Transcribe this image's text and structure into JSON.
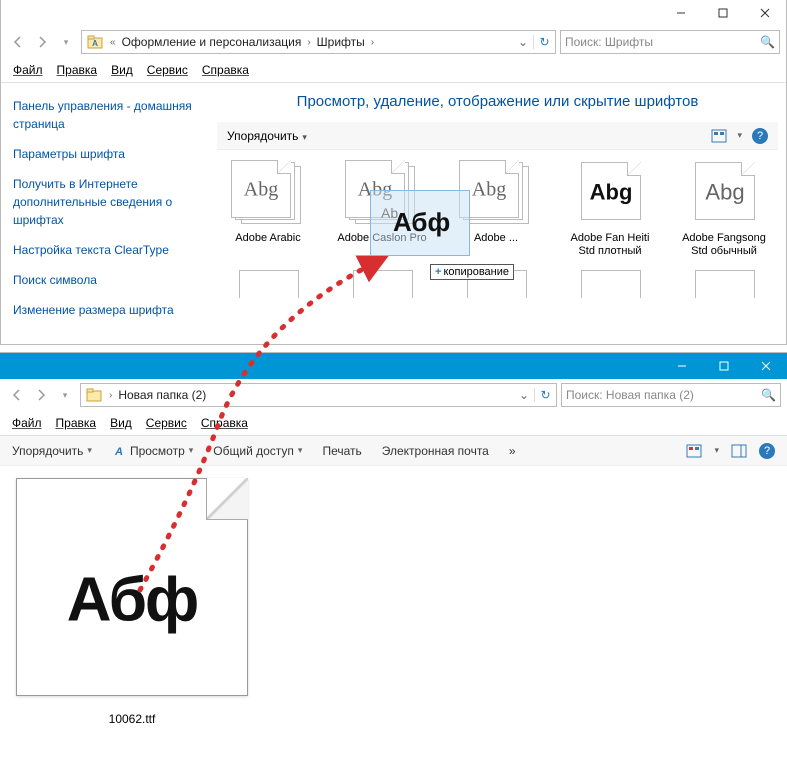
{
  "win1": {
    "breadcrumb": [
      "Оформление и персонализация",
      "Шрифты"
    ],
    "search_placeholder": "Поиск: Шрифты",
    "menu": [
      "Файл",
      "Правка",
      "Вид",
      "Сервис",
      "Справка"
    ],
    "sidebar": [
      "Панель управления - домашняя страница",
      "Параметры шрифта",
      "Получить в Интернете дополнительные сведения о шрифтах",
      "Настройка текста ClearType",
      "Поиск символа",
      "Изменение размера шрифта"
    ],
    "heading": "Просмотр, удаление, отображение или скрытие шрифтов",
    "organize": "Упорядочить",
    "fonts": [
      {
        "label": "Adobe Arabic",
        "sample": "Abg",
        "stacked": true,
        "style": ""
      },
      {
        "label": "Adobe Caslon Pro",
        "sample": "Abg",
        "stacked": true,
        "style": ""
      },
      {
        "label": "Adobe ...",
        "sample": "Abg",
        "stacked": true,
        "style": ""
      },
      {
        "label": "Adobe Fan Heiti Std плотный",
        "sample": "Abg",
        "stacked": false,
        "style": "bold"
      },
      {
        "label": "Adobe Fangsong Std обычный",
        "sample": "Abg",
        "stacked": false,
        "style": "thin"
      }
    ],
    "drag": {
      "ghost_small": "Ab",
      "ghost_big": "Абф",
      "tooltip": "копирование"
    }
  },
  "win2": {
    "breadcrumb": [
      "Новая папка (2)"
    ],
    "search_placeholder": "Поиск: Новая папка (2)",
    "menu": [
      "Файл",
      "Правка",
      "Вид",
      "Сервис",
      "Справка"
    ],
    "toolbar": {
      "organize": "Упорядочить",
      "preview": "Просмотр",
      "share": "Общий доступ",
      "print": "Печать",
      "email": "Электронная почта",
      "more": "»"
    },
    "file": {
      "name": "10062.ttf",
      "sample": "Абф"
    }
  }
}
